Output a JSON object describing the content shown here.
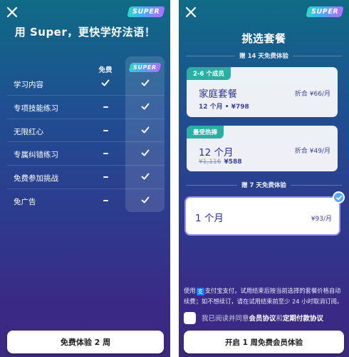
{
  "brand": {
    "badge_text": "SUPER",
    "gradient": [
      "#2fd6c9",
      "#4aa8ff",
      "#b86bff"
    ]
  },
  "left": {
    "close_icon": "close-icon",
    "headline": "用 Super，更快学好法语！",
    "free_column_label": "免费",
    "features": [
      {
        "label": "学习内容",
        "free": "check",
        "super": "check"
      },
      {
        "label": "专项技能练习",
        "free": "dash",
        "super": "check"
      },
      {
        "label": "无限红心",
        "free": "dash",
        "super": "check"
      },
      {
        "label": "专属纠错练习",
        "free": "dash",
        "super": "check"
      },
      {
        "label": "免费参加挑战",
        "free": "dash",
        "super": "check"
      },
      {
        "label": "免广告",
        "free": "dash",
        "super": "check"
      }
    ],
    "cta": "免费体验 2 周"
  },
  "right": {
    "close_icon": "close-icon",
    "title": "挑选套餐",
    "trial_14_label": "赠 14 天免费体验",
    "plans": [
      {
        "ribbon": "2-6 个成员",
        "name": "家庭套餐",
        "sub": "12 个月 • ¥798",
        "price": "折合 ¥66/月"
      },
      {
        "ribbon": "最受热捧",
        "name": "12 个月",
        "old_price": "¥1,116",
        "sub": "¥588",
        "price": "折合 ¥49/月"
      }
    ],
    "trial_7_label": "赠 7 天免费体验",
    "selected_plan": {
      "name": "1 个月",
      "price": "¥93/月"
    },
    "payment_note_prefix": "使用",
    "payment_method": "支付宝支付",
    "payment_note_rest": "，试用结束后按当前选择的套餐价格自动续费；如不想续订，请在试用结束前至少 24 小时取消订阅。",
    "agree_prefix": "我已阅读并同意",
    "agree_link1": "会员协议",
    "agree_and": "和",
    "agree_link2": "定期付款协议",
    "cta": "开启 1 周免费会员体验"
  }
}
